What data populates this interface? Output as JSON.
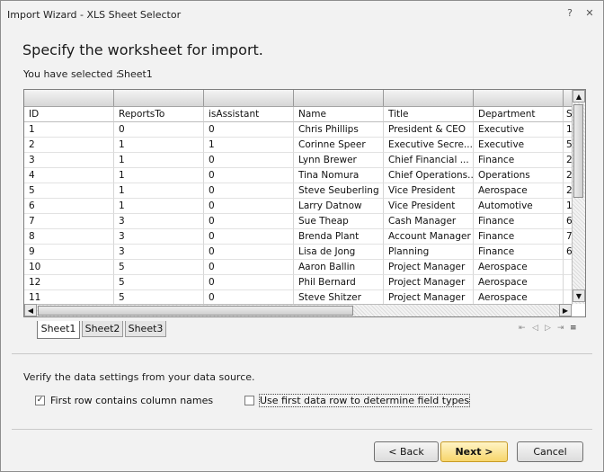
{
  "window": {
    "title": "Import Wizard - XLS Sheet Selector",
    "help_glyph": "?",
    "close_glyph": "✕"
  },
  "header": {
    "heading": "Specify the worksheet for import.",
    "selected_label": "You have selected :",
    "selected_value": "Sheet1"
  },
  "grid": {
    "columns": [
      "ID",
      "ReportsTo",
      "isAssistant",
      "Name",
      "Title",
      "Department",
      "S"
    ],
    "rows": [
      [
        "1",
        "0",
        "0",
        "Chris Phillips",
        "President & CEO",
        "Executive",
        "1"
      ],
      [
        "2",
        "1",
        "1",
        "Corinne Speer",
        "Executive Secre...",
        "Executive",
        "5"
      ],
      [
        "3",
        "1",
        "0",
        "Lynn Brewer",
        "Chief Financial ...",
        "Finance",
        "2"
      ],
      [
        "4",
        "1",
        "0",
        "Tina Nomura",
        "Chief Operations...",
        "Operations",
        "2"
      ],
      [
        "5",
        "1",
        "0",
        "Steve Seuberling",
        "Vice President",
        "Aerospace",
        "2"
      ],
      [
        "6",
        "1",
        "0",
        "Larry Datnow",
        "Vice President",
        "Automotive",
        "1"
      ],
      [
        "7",
        "3",
        "0",
        "Sue Theap",
        "Cash Manager",
        "Finance",
        "6"
      ],
      [
        "8",
        "3",
        "0",
        "Brenda Plant",
        "Account Manager",
        "Finance",
        "7"
      ],
      [
        "9",
        "3",
        "0",
        "Lisa de Jong",
        "Planning",
        "Finance",
        "6"
      ],
      [
        "10",
        "5",
        "0",
        "Aaron Ballin",
        "Project Manager",
        "Aerospace",
        ""
      ],
      [
        "12",
        "5",
        "0",
        "Phil Bernard",
        "Project Manager",
        "Aerospace",
        ""
      ],
      [
        "11",
        "5",
        "0",
        "Steve Shitzer",
        "Project Manager",
        "Aerospace",
        ""
      ]
    ],
    "scroll_up": "▲",
    "scroll_down": "▼",
    "scroll_left": "◀",
    "scroll_right": "▶"
  },
  "sheets": {
    "tabs": [
      "Sheet1",
      "Sheet2",
      "Sheet3"
    ],
    "active": "Sheet1",
    "nav": [
      "⇤",
      "◁",
      "▷",
      "⇥",
      "≡"
    ]
  },
  "settings": {
    "verify_text": "Verify the data settings from your data source.",
    "first_row_names": {
      "label": "First row contains column names",
      "checked": true,
      "mark": "✓"
    },
    "first_data_row_types": {
      "label": "Use first data row to determine field types",
      "checked": false
    }
  },
  "buttons": {
    "back": "< Back",
    "next": "Next >",
    "cancel": "Cancel"
  }
}
